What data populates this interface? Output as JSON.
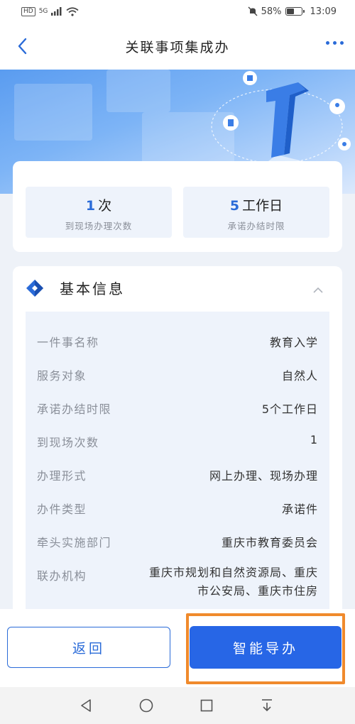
{
  "status_bar": {
    "hd": "HD",
    "network": "5G",
    "battery": "58%",
    "battery_level": 0.58,
    "time": "13:09"
  },
  "nav": {
    "title": "关联事项集成办",
    "back_icon": "chevron-left-icon",
    "more_icon": "more-dots-icon"
  },
  "summary": {
    "visits": {
      "value": "1",
      "unit": "次",
      "label": "到现场办理次数"
    },
    "deadline": {
      "value": "5",
      "unit": "工作日",
      "label": "承诺办结时限"
    }
  },
  "basic_info": {
    "title": "基本信息",
    "rows": [
      {
        "label": "一件事名称",
        "value": "教育入学"
      },
      {
        "label": "服务对象",
        "value": "自然人"
      },
      {
        "label": "承诺办结时限",
        "value": "5个工作日"
      },
      {
        "label": "到现场次数",
        "value": "1"
      },
      {
        "label": "办理形式",
        "value": "网上办理、现场办理"
      },
      {
        "label": "办件类型",
        "value": "承诺件"
      },
      {
        "label": "牵头实施部门",
        "value": "重庆市教育委员会"
      },
      {
        "label": "联办机构",
        "value": "重庆市规划和自然资源局、重庆市公安局、重庆市住房"
      }
    ]
  },
  "actions": {
    "return_label": "返回",
    "guide_label": "智能导办"
  },
  "colors": {
    "accent": "#2a6bd8",
    "primary_button": "#2766e6",
    "highlight": "#f08a2c"
  }
}
